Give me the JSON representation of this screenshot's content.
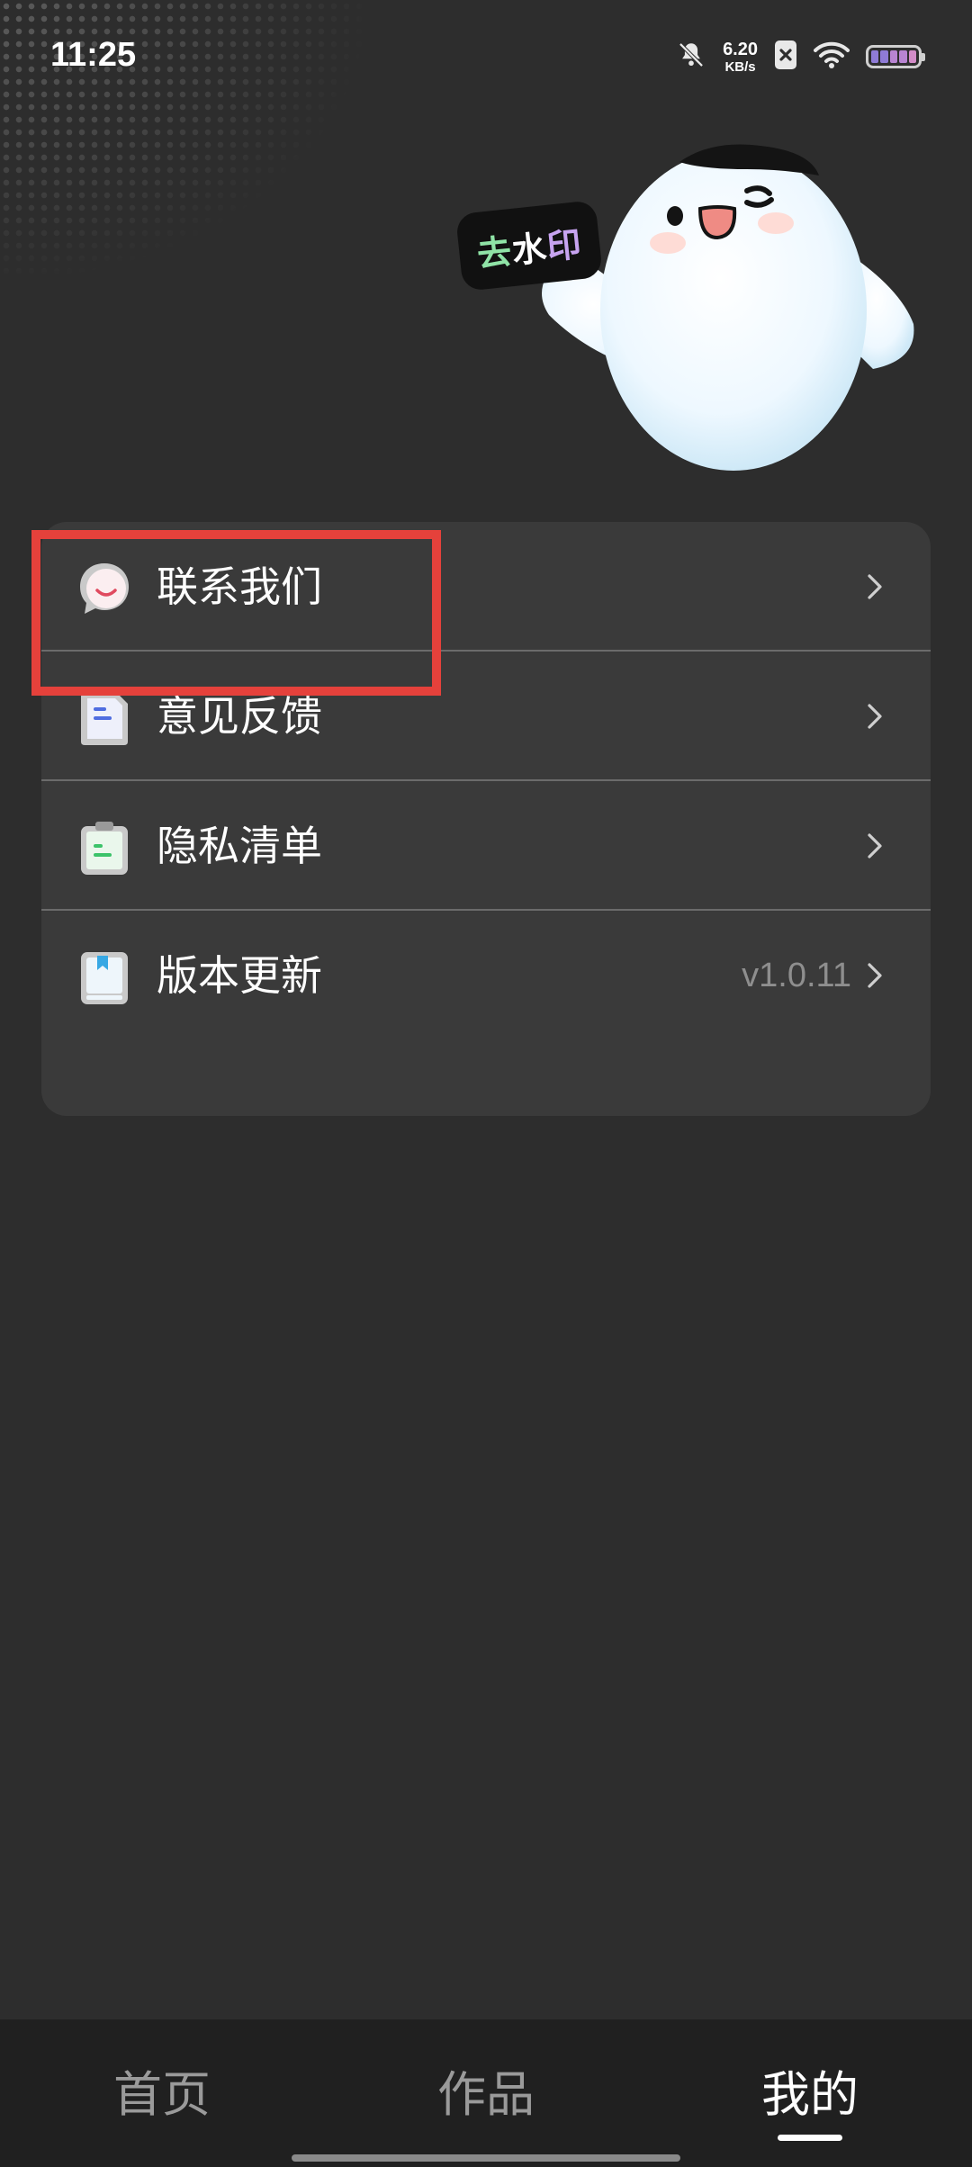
{
  "status_bar": {
    "time": "11:25",
    "net_speed_value": "6.20",
    "net_speed_unit": "KB/s"
  },
  "mascot": {
    "sticker_char1": "去",
    "sticker_char2": "水",
    "sticker_char3": "印"
  },
  "menu": {
    "items": [
      {
        "label": "联系我们",
        "icon": "chat-bubble-icon",
        "value": ""
      },
      {
        "label": "意见反馈",
        "icon": "document-icon",
        "value": ""
      },
      {
        "label": "隐私清单",
        "icon": "clipboard-icon",
        "value": ""
      },
      {
        "label": "版本更新",
        "icon": "book-icon",
        "value": "v1.0.11"
      }
    ]
  },
  "bottom_nav": {
    "tabs": [
      {
        "label": "首页"
      },
      {
        "label": "作品"
      },
      {
        "label": "我的"
      }
    ],
    "active_tab": "我的"
  },
  "colors": {
    "background": "#2d2d2d",
    "card": "#3a3a3a",
    "highlight_box": "#e5413b",
    "nav_background": "#202020",
    "inactive_text": "#9a9a9a"
  }
}
